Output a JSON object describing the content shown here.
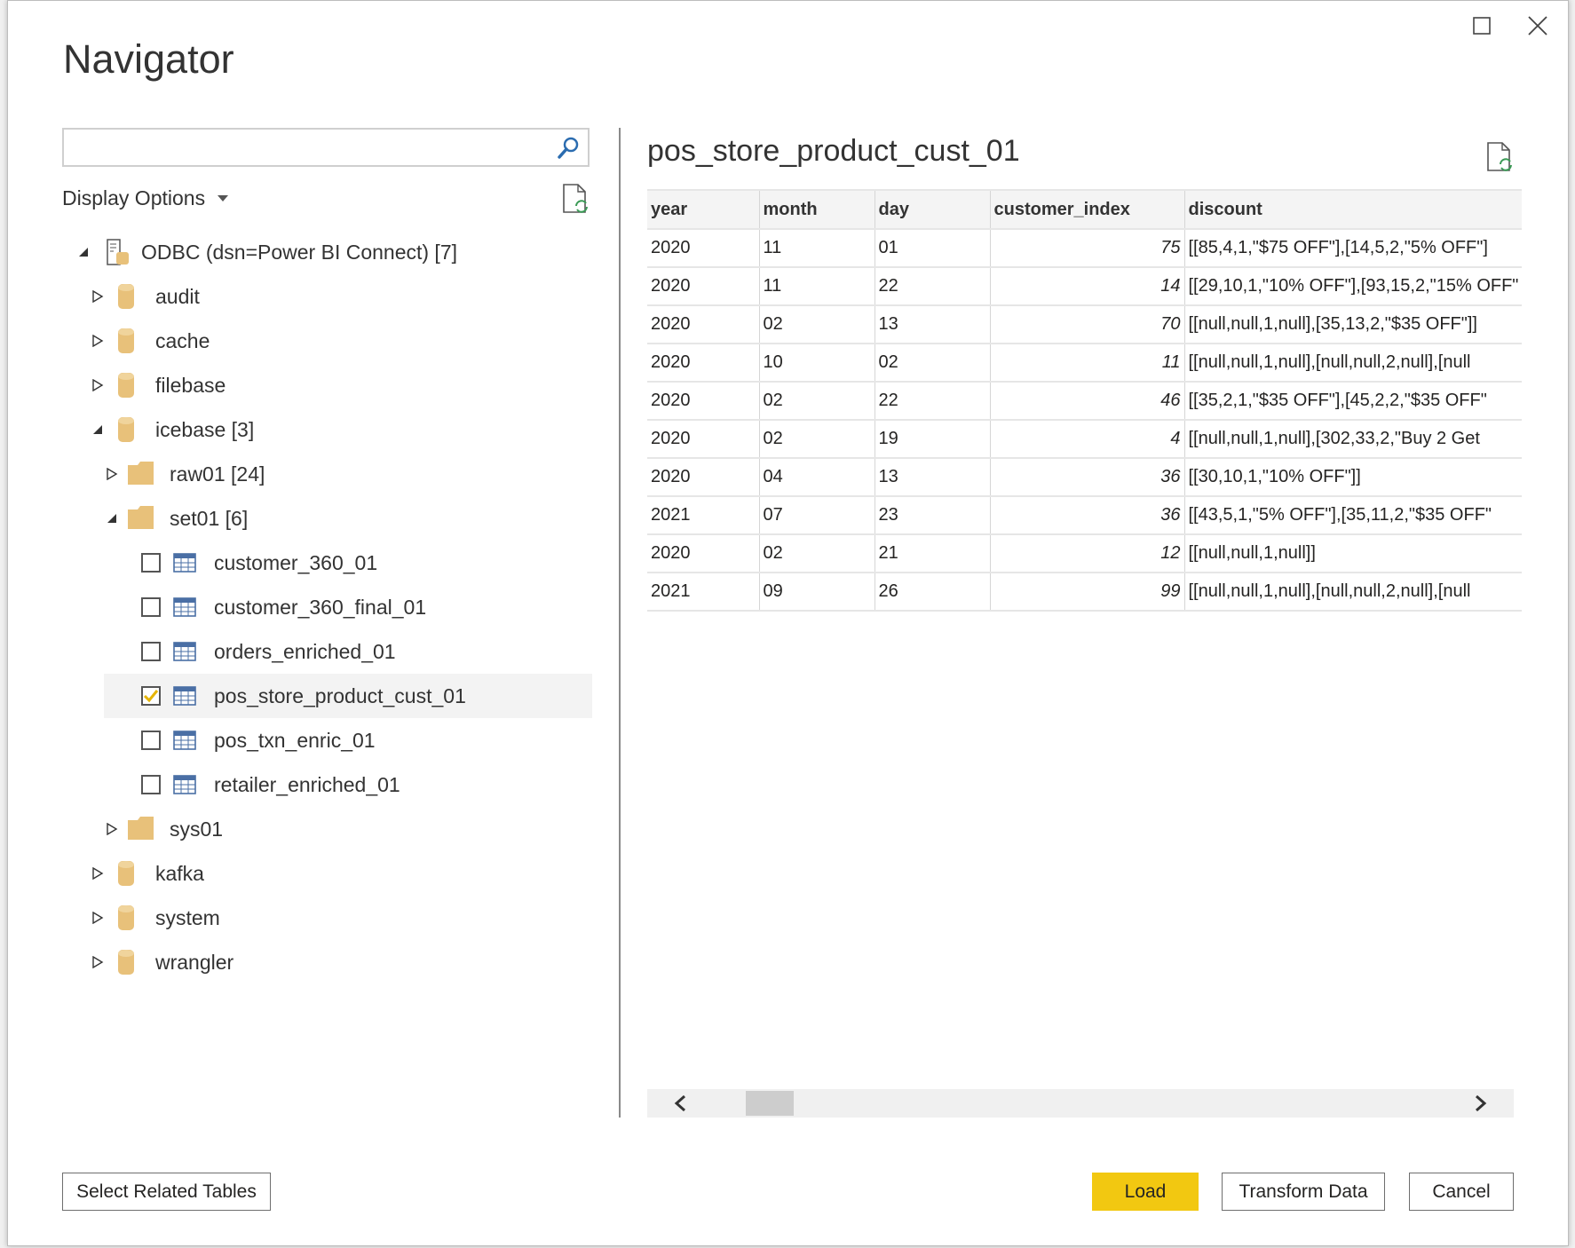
{
  "window": {
    "title": "Navigator",
    "maximize_icon": "maximize-icon",
    "close_icon": "close-icon"
  },
  "search": {
    "value": "",
    "placeholder": ""
  },
  "display_options": {
    "label": "Display Options"
  },
  "tree": [
    {
      "label": "ODBC (dsn=Power BI Connect) [7]",
      "icon": "server-database",
      "level": 0,
      "expanded": true
    },
    {
      "label": "audit",
      "icon": "database",
      "level": 1,
      "expanded": false
    },
    {
      "label": "cache",
      "icon": "database",
      "level": 1,
      "expanded": false
    },
    {
      "label": "filebase",
      "icon": "database",
      "level": 1,
      "expanded": false
    },
    {
      "label": "icebase [3]",
      "icon": "database",
      "level": 1,
      "expanded": true
    },
    {
      "label": "raw01 [24]",
      "icon": "folder",
      "level": 2,
      "expanded": false
    },
    {
      "label": "set01 [6]",
      "icon": "folder",
      "level": 2,
      "expanded": true
    },
    {
      "label": "customer_360_01",
      "icon": "table",
      "level": 3,
      "checked": false
    },
    {
      "label": "customer_360_final_01",
      "icon": "table",
      "level": 3,
      "checked": false
    },
    {
      "label": "orders_enriched_01",
      "icon": "table",
      "level": 3,
      "checked": false
    },
    {
      "label": "pos_store_product_cust_01",
      "icon": "table",
      "level": 3,
      "checked": true,
      "selected": true
    },
    {
      "label": "pos_txn_enric_01",
      "icon": "table",
      "level": 3,
      "checked": false
    },
    {
      "label": "retailer_enriched_01",
      "icon": "table",
      "level": 3,
      "checked": false
    },
    {
      "label": "sys01",
      "icon": "folder",
      "level": 2,
      "expanded": false
    },
    {
      "label": "kafka",
      "icon": "database",
      "level": 1,
      "expanded": false
    },
    {
      "label": "system",
      "icon": "database",
      "level": 1,
      "expanded": false
    },
    {
      "label": "wrangler",
      "icon": "database",
      "level": 1,
      "expanded": false
    }
  ],
  "preview": {
    "title": "pos_store_product_cust_01",
    "columns": [
      "year",
      "month",
      "day",
      "customer_index",
      "discount"
    ],
    "rows": [
      [
        "2020",
        "11",
        "01",
        "75",
        "[[85,4,1,\"$75 OFF\"],[14,5,2,\"5% OFF\"]"
      ],
      [
        "2020",
        "11",
        "22",
        "14",
        "[[29,10,1,\"10% OFF\"],[93,15,2,\"15% OFF\""
      ],
      [
        "2020",
        "02",
        "13",
        "70",
        "[[null,null,1,null],[35,13,2,\"$35 OFF\"]]"
      ],
      [
        "2020",
        "10",
        "02",
        "11",
        "[[null,null,1,null],[null,null,2,null],[null"
      ],
      [
        "2020",
        "02",
        "22",
        "46",
        "[[35,2,1,\"$35 OFF\"],[45,2,2,\"$35 OFF\""
      ],
      [
        "2020",
        "02",
        "19",
        "4",
        "[[null,null,1,null],[302,33,2,\"Buy 2 Get"
      ],
      [
        "2020",
        "04",
        "13",
        "36",
        "[[30,10,1,\"10% OFF\"]]"
      ],
      [
        "2021",
        "07",
        "23",
        "36",
        "[[43,5,1,\"5% OFF\"],[35,11,2,\"$35 OFF\""
      ],
      [
        "2020",
        "02",
        "21",
        "12",
        "[[null,null,1,null]]"
      ],
      [
        "2021",
        "09",
        "26",
        "99",
        "[[null,null,1,null],[null,null,2,null],[null"
      ]
    ]
  },
  "buttons": {
    "select_related": "Select Related Tables",
    "load": "Load",
    "transform": "Transform Data",
    "cancel": "Cancel"
  },
  "colors": {
    "accent": "#f2c811",
    "db_icon": "#e8c17a",
    "checkbox_check": "#e6b400",
    "table_icon": "#4a6fa5"
  }
}
